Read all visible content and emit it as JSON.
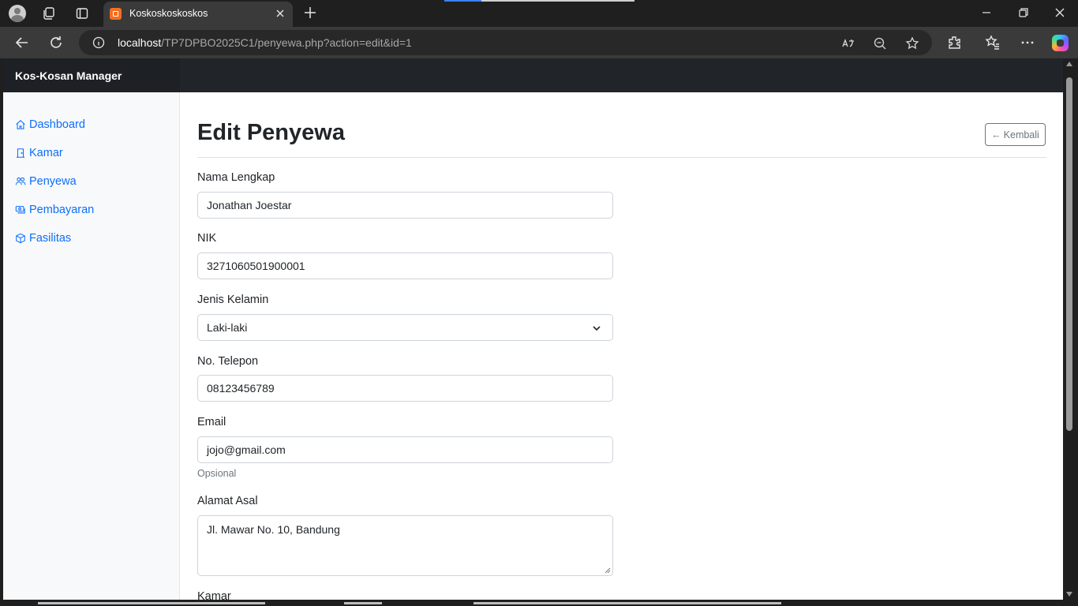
{
  "browser": {
    "tab_title": "Koskoskoskoskos",
    "url_host": "localhost",
    "url_path": "/TP7DPBO2025C1/penyewa.php?action=edit&id=1"
  },
  "app": {
    "brand": "Kos-Kosan Manager",
    "sidebar": {
      "items": [
        {
          "label": "Dashboard",
          "icon": "house-icon"
        },
        {
          "label": "Kamar",
          "icon": "door-icon"
        },
        {
          "label": "Penyewa",
          "icon": "people-icon"
        },
        {
          "label": "Pembayaran",
          "icon": "cash-icon"
        },
        {
          "label": "Fasilitas",
          "icon": "box-icon"
        }
      ]
    },
    "page": {
      "title": "Edit Penyewa",
      "back_arrow": "←",
      "back_label": "Kembali"
    },
    "form": {
      "nama": {
        "label": "Nama Lengkap",
        "value": "Jonathan Joestar"
      },
      "nik": {
        "label": "NIK",
        "value": "3271060501900001"
      },
      "jenis_kelamin": {
        "label": "Jenis Kelamin",
        "value": "Laki-laki"
      },
      "telepon": {
        "label": "No. Telepon",
        "value": "08123456789"
      },
      "email": {
        "label": "Email",
        "value": "jojo@gmail.com",
        "help": "Opsional"
      },
      "alamat": {
        "label": "Alamat Asal",
        "value": "Jl. Mawar No. 10, Bandung"
      },
      "kamar": {
        "label": "Kamar"
      }
    }
  },
  "colors": {
    "link": "#0d6efd",
    "navbar": "#212529",
    "sidebar_bg": "#f8f9fa",
    "secondary": "#6c757d"
  }
}
